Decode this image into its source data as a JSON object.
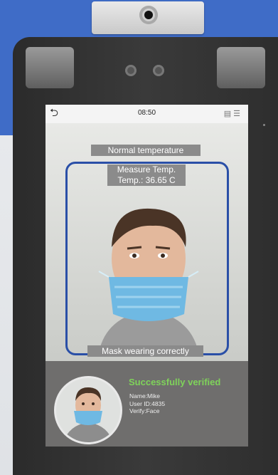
{
  "screen": {
    "clock": "08:50",
    "status_banner": "Normal temperature",
    "measure_title": "Measure Temp.",
    "temperature": "Temp.: 36.65 C",
    "mask_status": "Mask wearing correctly",
    "result": {
      "title": "Successfully verified",
      "name": "Name:Mike",
      "user_id": "User ID:4835",
      "verify": "Verify:Face"
    }
  },
  "colors": {
    "accent_blue": "#3f6cc7",
    "frame_blue": "#2a4fa7",
    "success_green": "#7fd35a",
    "mask_blue": "#6fb9e3"
  },
  "icons": [
    "back-icon",
    "keyboard-icon",
    "menu-icon",
    "camera-lens-icon"
  ]
}
